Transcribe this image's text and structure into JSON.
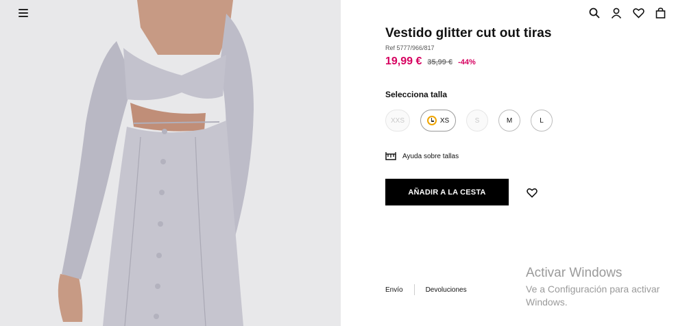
{
  "product": {
    "title": "Vestido glitter cut out tiras",
    "ref": "Ref 5777/966/817",
    "price_now": "19,99 €",
    "price_old": "35,99 €",
    "discount": "-44%"
  },
  "sizes": {
    "label": "Selecciona talla",
    "options": [
      {
        "label": "XXS",
        "available": false
      },
      {
        "label": "XS",
        "available": true,
        "low_stock": true
      },
      {
        "label": "S",
        "available": false
      },
      {
        "label": "M",
        "available": true
      },
      {
        "label": "L",
        "available": true
      }
    ]
  },
  "help": {
    "label": "Ayuda sobre tallas",
    "icon": "ruler-icon"
  },
  "cart": {
    "add_label": "AÑADIR A LA CESTA"
  },
  "links": {
    "shipping": "Envío",
    "returns": "Devoluciones"
  },
  "header": {
    "icons": [
      "search-icon",
      "user-icon",
      "heart-icon",
      "bag-icon"
    ]
  },
  "watermark": {
    "title": "Activar Windows",
    "subtitle": "Ve a Configuración para activar Windows."
  },
  "colors": {
    "accent_price": "#d6005f",
    "button_bg": "#000000",
    "image_bg": "#e7e7e9"
  }
}
